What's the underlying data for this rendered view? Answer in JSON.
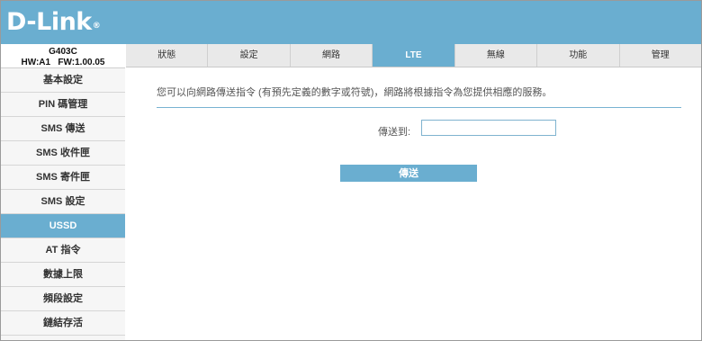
{
  "brand": {
    "logo": "D-Link",
    "trademark": "®"
  },
  "device": {
    "model": "G403C",
    "versions": "HW:A1   FW:1.00.05"
  },
  "sidebar": {
    "items": [
      {
        "label": "基本設定"
      },
      {
        "label": "PIN 碼管理"
      },
      {
        "label": "SMS 傳送"
      },
      {
        "label": "SMS 收件匣"
      },
      {
        "label": "SMS 寄件匣"
      },
      {
        "label": "SMS 設定"
      },
      {
        "label": "USSD"
      },
      {
        "label": "AT 指令"
      },
      {
        "label": "數據上限"
      },
      {
        "label": "頻段設定"
      },
      {
        "label": "鏈結存活"
      }
    ],
    "active_index": 6
  },
  "tabs": [
    {
      "label": "狀態"
    },
    {
      "label": "設定"
    },
    {
      "label": "網路"
    },
    {
      "label": "LTE"
    },
    {
      "label": "無線"
    },
    {
      "label": "功能"
    },
    {
      "label": "管理"
    }
  ],
  "active_tab_index": 3,
  "main": {
    "description": "您可以向網路傳送指令 (有預先定義的數字或符號)，網路將根據指令為您提供相應的服務。",
    "send_to_label": "傳送到:",
    "send_to_value": "",
    "send_button": "傳送"
  },
  "colors": {
    "accent": "#6aaed0",
    "rule": "#78b3d2"
  }
}
